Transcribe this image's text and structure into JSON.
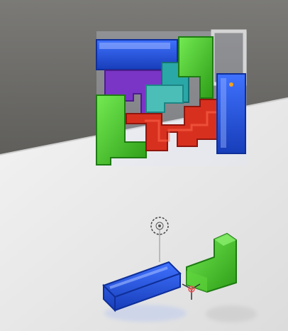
{
  "scene": {
    "title": "",
    "board": {
      "frame_color": "#d8d8d8",
      "pieces_placed": 8,
      "empty_slot": true
    },
    "loose_pieces": [
      {
        "color_name": "blue",
        "color": "#1e52d6",
        "shape": "I"
      },
      {
        "color_name": "green",
        "color": "#37b51c",
        "shape": "L"
      }
    ],
    "colors": {
      "ground_dark": "#6f6f6c",
      "ground_light": "#efefef",
      "blue": "#1e52d6",
      "green": "#37b51c",
      "purple": "#7a35c6",
      "teal": "#2aa7a7",
      "red": "#d8301f",
      "highlight": "#f3a21c"
    },
    "gizmo": {
      "name": "light-gizmo-icon",
      "transform_name": "move-gizmo-icon"
    }
  }
}
